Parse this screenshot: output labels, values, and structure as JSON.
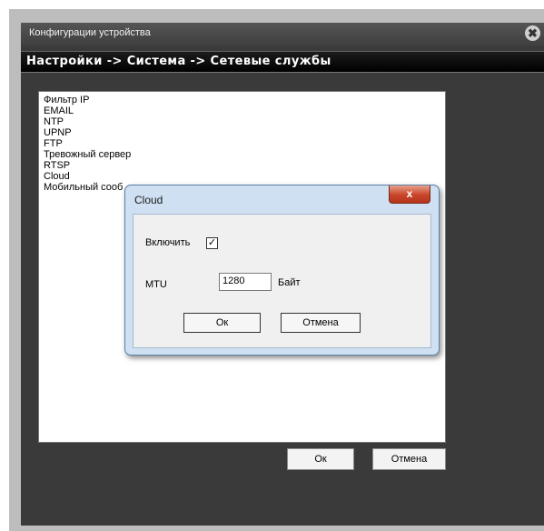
{
  "window": {
    "title": "Конфигурации устройства",
    "close_icon": "✖",
    "breadcrumb": "Настройки -> Система -> Сетевые службы"
  },
  "services": {
    "items": [
      {
        "label": "Фильтр IP"
      },
      {
        "label": "EMAIL"
      },
      {
        "label": "NTP"
      },
      {
        "label": "UPNP"
      },
      {
        "label": "FTP"
      },
      {
        "label": "Тревожный сервер"
      },
      {
        "label": "RTSP"
      },
      {
        "label": "Cloud"
      },
      {
        "label": "Мобильный сооб"
      }
    ]
  },
  "main_buttons": {
    "ok": "Ок",
    "cancel": "Отмена"
  },
  "dialog": {
    "title": "Cloud",
    "close_icon": "x",
    "enable_label": "Включить",
    "enable_checked": "✓",
    "mtu_label": "MTU",
    "mtu_value": "1280",
    "mtu_unit": "Байт",
    "ok": "Ок",
    "cancel": "Отмена"
  }
}
